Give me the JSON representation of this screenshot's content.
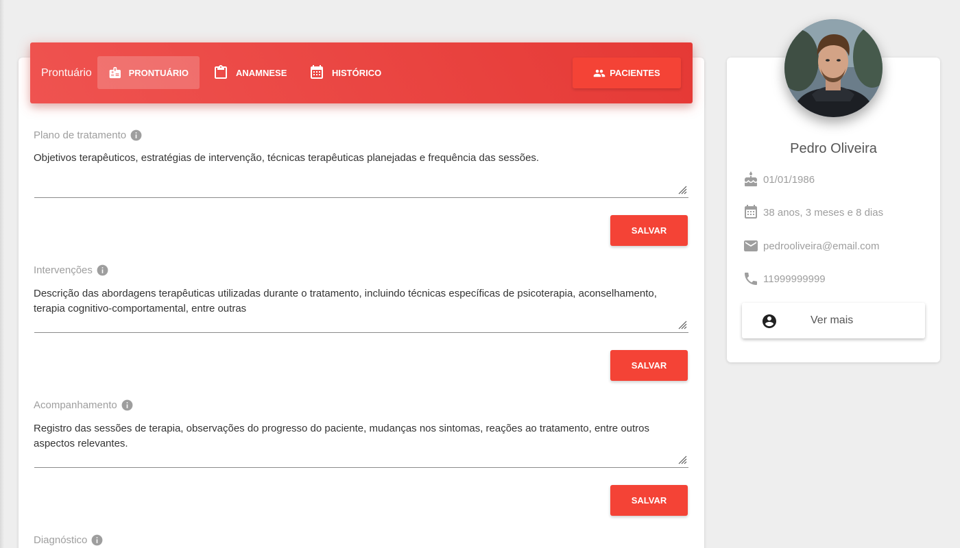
{
  "header": {
    "title": "Prontuário",
    "tabs": [
      {
        "label": "PRONTUÁRIO",
        "icon": "medical-card-icon",
        "active": true
      },
      {
        "label": "ANAMNESE",
        "icon": "clipboard-icon",
        "active": false
      },
      {
        "label": "HISTÓRICO",
        "icon": "calendar-icon",
        "active": false
      }
    ],
    "pacientes_label": "PACIENTES",
    "accent_color": "#f44336"
  },
  "fields": [
    {
      "label": "Plano de tratamento",
      "value": "Objetivos terapêuticos, estratégias de intervenção, técnicas terapêuticas planejadas e frequência das sessões.",
      "save_label": "SALVAR"
    },
    {
      "label": "Intervenções",
      "value": "Descrição das abordagens terapêuticas utilizadas durante o tratamento, incluindo técnicas específicas de psicoterapia, aconselhamento, terapia cognitivo-comportamental, entre outras",
      "save_label": "SALVAR"
    },
    {
      "label": "Acompanhamento",
      "value": "Registro das sessões de terapia, observações do progresso do paciente, mudanças nos sintomas, reações ao tratamento, entre outros aspectos relevantes.",
      "save_label": "SALVAR"
    },
    {
      "label": "Diagnóstico"
    }
  ],
  "patient": {
    "name": "Pedro Oliveira",
    "birthdate": "01/01/1986",
    "age": "38 anos, 3 meses e 8 dias",
    "email": "pedrooliveira@email.com",
    "phone": "11999999999",
    "ver_mais_label": "Ver mais"
  }
}
